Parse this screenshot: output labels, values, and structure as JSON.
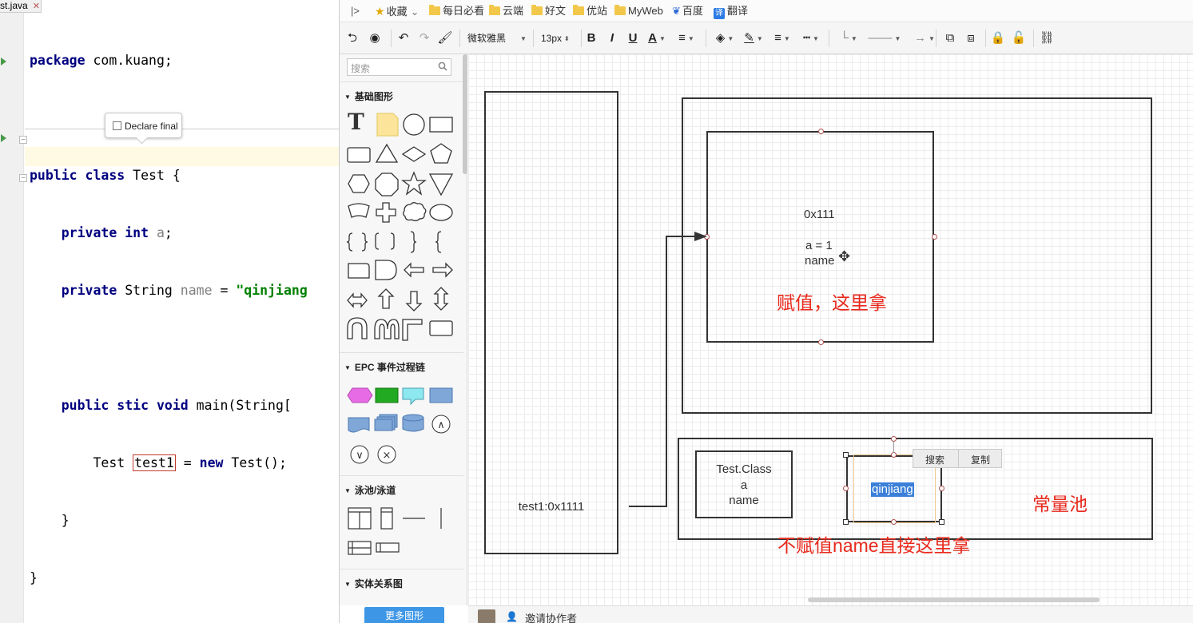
{
  "ide": {
    "tab_label": "st.java",
    "tab_close": "✕",
    "code": {
      "l1_kw": "package",
      "l1_rest": " com.kuang;",
      "l3_kw": "public class",
      "l3_rest": " Test {",
      "l4_kw": "private int",
      "l4_field": "a",
      "l4_end": ";",
      "l5_kw": "private",
      "l5_type": " String ",
      "l5_field": "name",
      "l5_eq": " = ",
      "l5_str": "\"qinjiang",
      "l7_kw1": "public",
      "l7_hidden": " s",
      "l7_kw2": "tic void",
      "l7_rest": " main(String[",
      "l8_type": "Test ",
      "l8_var": "test1",
      "l8_eq": " = ",
      "l8_kw": "new",
      "l8_rest": " Test();",
      "l9": "}",
      "l10": "}"
    },
    "tooltip_label": "Declare final"
  },
  "bookmarks": {
    "collapse_icon": "|>",
    "items": [
      {
        "label": "收藏",
        "caret": "⌄"
      },
      {
        "label": "每日必看"
      },
      {
        "label": "云端"
      },
      {
        "label": "好文"
      },
      {
        "label": "优站"
      },
      {
        "label": "MyWeb"
      },
      {
        "label": "百度"
      },
      {
        "label": "翻译"
      }
    ],
    "fanyi_badge": "译"
  },
  "toolbar": {
    "font_family": "微软雅黑",
    "font_size": "13px",
    "bold": "B",
    "italic": "I",
    "underline": "U",
    "font_color": "A",
    "align": "≡",
    "line_style": "≡",
    "connector_label": "→"
  },
  "panel": {
    "search_placeholder": "搜索",
    "sections": [
      {
        "title": "基础图形"
      },
      {
        "title": "EPC 事件过程链"
      },
      {
        "title": "泳池/泳道"
      },
      {
        "title": "实体关系图"
      }
    ],
    "more_shapes": "更多图形"
  },
  "canvas": {
    "stack_label": "test1:0x1111",
    "object_addr": "0x111",
    "object_field_a": "a = 1",
    "object_field_name": "name",
    "annotation_assign": "赋值，这里拿",
    "class_box_title": "Test.Class",
    "class_box_a": "a",
    "class_box_name": "name",
    "selected_text": "qinjiang",
    "pool_label": "常量池",
    "annotation_direct": "不赋值name直接这里拿",
    "context_menu": {
      "search": "搜索",
      "copy": "复制"
    }
  },
  "bottom_bar": {
    "invite": "邀请协作者"
  },
  "colors": {
    "annotation_red": "#e8291c",
    "selection_blue": "#3b7fd9",
    "keyword_navy": "#000080",
    "string_green": "#008000",
    "field_purple": "#660e7a",
    "more_button_blue": "#3d96e6"
  }
}
